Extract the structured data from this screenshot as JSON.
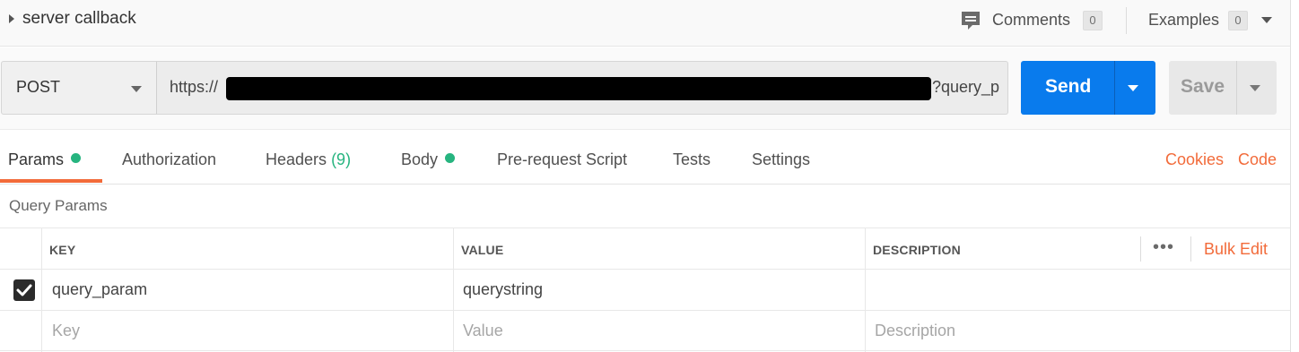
{
  "header": {
    "request_name": "server callback",
    "comments_label": "Comments",
    "comments_count": "0",
    "examples_label": "Examples",
    "examples_count": "0"
  },
  "request": {
    "method": "POST",
    "url_prefix": "https://",
    "url_suffix": "?query_p",
    "send_label": "Send",
    "save_label": "Save"
  },
  "tabs": [
    {
      "label": "Params",
      "active": true,
      "dot": true
    },
    {
      "label": "Authorization"
    },
    {
      "label": "Headers",
      "count": "(9)"
    },
    {
      "label": "Body",
      "dot": true
    },
    {
      "label": "Pre-request Script"
    },
    {
      "label": "Tests"
    },
    {
      "label": "Settings"
    }
  ],
  "links": {
    "cookies": "Cookies",
    "code": "Code"
  },
  "query_params": {
    "title": "Query Params",
    "columns": [
      "KEY",
      "VALUE",
      "DESCRIPTION"
    ],
    "bulk_edit": "Bulk Edit",
    "more": "•••",
    "rows": [
      {
        "checked": true,
        "key": "query_param",
        "value": "querystring",
        "description": ""
      }
    ],
    "placeholders": {
      "key": "Key",
      "value": "Value",
      "description": "Description"
    }
  },
  "colors": {
    "accent": "#f26b3a",
    "send": "#097bed",
    "status_dot": "#26b47f"
  }
}
